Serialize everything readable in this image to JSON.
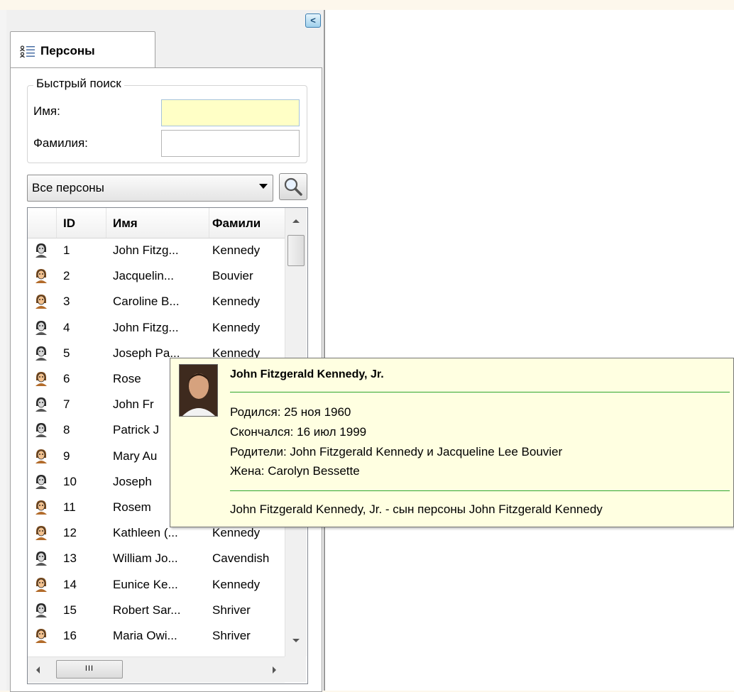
{
  "panel": {
    "tab_label": "Персоны",
    "collapse_glyph": "<",
    "quick_search": {
      "legend": "Быстрый поиск",
      "first_name_label": "Имя:",
      "first_name_value": "",
      "last_name_label": "Фамилия:",
      "last_name_value": ""
    },
    "filter": {
      "selected": "Все персоны"
    },
    "grid": {
      "columns": [
        "ID",
        "Имя",
        "Фамилия"
      ],
      "header_display": [
        "ID",
        "Имя",
        "Фамили"
      ],
      "rows": [
        {
          "id": "1",
          "first": "John Fitzg...",
          "last": "Kennedy",
          "icon": "male-person-icon"
        },
        {
          "id": "2",
          "first": "Jacquelin...",
          "last": "Bouvier",
          "icon": "female-person-icon"
        },
        {
          "id": "3",
          "first": "Caroline B...",
          "last": "Kennedy",
          "icon": "female-person-icon"
        },
        {
          "id": "4",
          "first": "John Fitzg...",
          "last": "Kennedy",
          "icon": "male-person-icon"
        },
        {
          "id": "5",
          "first": "Joseph Pa...",
          "last": "Kennedy",
          "icon": "male-person-icon"
        },
        {
          "id": "6",
          "first": "Rose",
          "last": "",
          "icon": "female-person-icon"
        },
        {
          "id": "7",
          "first": "John Fr",
          "last": "",
          "icon": "male-person-icon"
        },
        {
          "id": "8",
          "first": "Patrick J",
          "last": "",
          "icon": "male-person-icon"
        },
        {
          "id": "9",
          "first": "Mary Au",
          "last": "",
          "icon": "female-person-icon"
        },
        {
          "id": "10",
          "first": "Joseph",
          "last": "",
          "icon": "male-person-icon"
        },
        {
          "id": "11",
          "first": "Rosem",
          "last": "",
          "icon": "female-person-icon"
        },
        {
          "id": "12",
          "first": "Kathleen (...",
          "last": "Kennedy",
          "icon": "female-person-icon"
        },
        {
          "id": "13",
          "first": "William Jo...",
          "last": "Cavendish",
          "icon": "male-person-icon"
        },
        {
          "id": "14",
          "first": "Eunice Ke...",
          "last": "Kennedy",
          "icon": "female-person-icon"
        },
        {
          "id": "15",
          "first": "Robert Sar...",
          "last": "Shriver",
          "icon": "male-person-icon"
        },
        {
          "id": "16",
          "first": "Maria Owi...",
          "last": "Shriver",
          "icon": "female-person-icon"
        }
      ],
      "scroll_thumb_glyph": "III"
    }
  },
  "tooltip": {
    "name": "John Fitzgerald Kennedy, Jr.",
    "born": "Родился: 25 ноя 1960",
    "died": "Скончался: 16 июл 1999",
    "parents": "Родители: John Fitzgerald Kennedy и Jacqueline Lee Bouvier",
    "spouse": "Жена: Carolyn Bessette",
    "relation": "John Fitzgerald Kennedy, Jr. - сын персоны John Fitzgerald Kennedy"
  },
  "colors": {
    "focused_input": "#ffffc6",
    "tooltip_bg": "#ffffe1",
    "tooltip_rule": "#2ea52e",
    "collapse_button": "#9fd0ec"
  }
}
